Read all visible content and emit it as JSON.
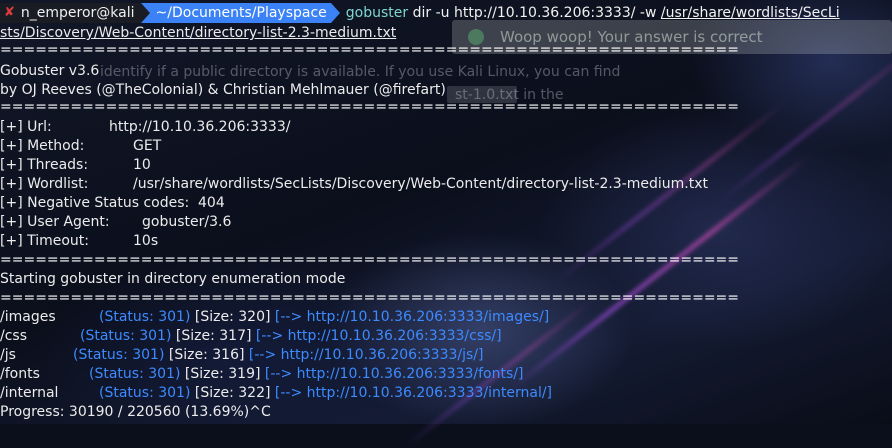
{
  "prompt": {
    "user_host": "n_emperor@kali",
    "cwd": "~/Documents/Playspace",
    "command_bin": "gobuster",
    "command_args": " dir -u http://10.10.36.206:3333/ -w ",
    "command_wordlist_part1": "/usr/share/wordlists/SecLi",
    "command_wordlist_part2": "sts/Discovery/Web-Content/directory-list-2.3-medium.txt"
  },
  "separator": "===============================================================",
  "banner": {
    "version": "Gobuster v3.6",
    "authors": "by OJ Reeves (@TheColonial) & Christian Mehlmauer (@firefart)"
  },
  "config": [
    {
      "key": "[+] Url:",
      "value": "http://10.10.36.206:3333/"
    },
    {
      "key": "[+] Method:",
      "value": "GET"
    },
    {
      "key": "[+] Threads:",
      "value": "10"
    },
    {
      "key": "[+] Wordlist:",
      "value": "/usr/share/wordlists/SecLists/Discovery/Web-Content/directory-list-2.3-medium.txt"
    },
    {
      "key": "[+] Negative Status codes:",
      "value": "404"
    },
    {
      "key": "[+] User Agent:",
      "value": "gobuster/3.6"
    },
    {
      "key": "[+] Timeout:",
      "value": "10s"
    }
  ],
  "start_message": "Starting gobuster in directory enumeration mode",
  "results": [
    {
      "path": "/images",
      "status": "(Status: 301)",
      "size": "[Size: 320]",
      "redirect": "[--> http://10.10.36.206:3333/images/]"
    },
    {
      "path": "/css",
      "status": "(Status: 301)",
      "size": "[Size: 317]",
      "redirect": "[--> http://10.10.36.206:3333/css/]"
    },
    {
      "path": "/js",
      "status": "(Status: 301)",
      "size": "[Size: 316]",
      "redirect": "[--> http://10.10.36.206:3333/js/]"
    },
    {
      "path": "/fonts",
      "status": "(Status: 301)",
      "size": "[Size: 319]",
      "redirect": "[--> http://10.10.36.206:3333/fonts/]"
    },
    {
      "path": "/internal",
      "status": "(Status: 301)",
      "size": "[Size: 322]",
      "redirect": "[--> http://10.10.36.206:3333/internal/]"
    }
  ],
  "progress": "Progress: 30190 / 220560 (13.69%)^C",
  "background_page": {
    "alert": "Woop woop! Your answer is correct",
    "line1": "identify if a public directory is available. If you use Kali Linux, you can find",
    "line2_code": "st-1.0.txt",
    "line2_after": "in the"
  },
  "colors": {
    "accent_blue": "#3b82f6",
    "status_blue": "#3d8bff",
    "error_x": "#e23b3b"
  }
}
